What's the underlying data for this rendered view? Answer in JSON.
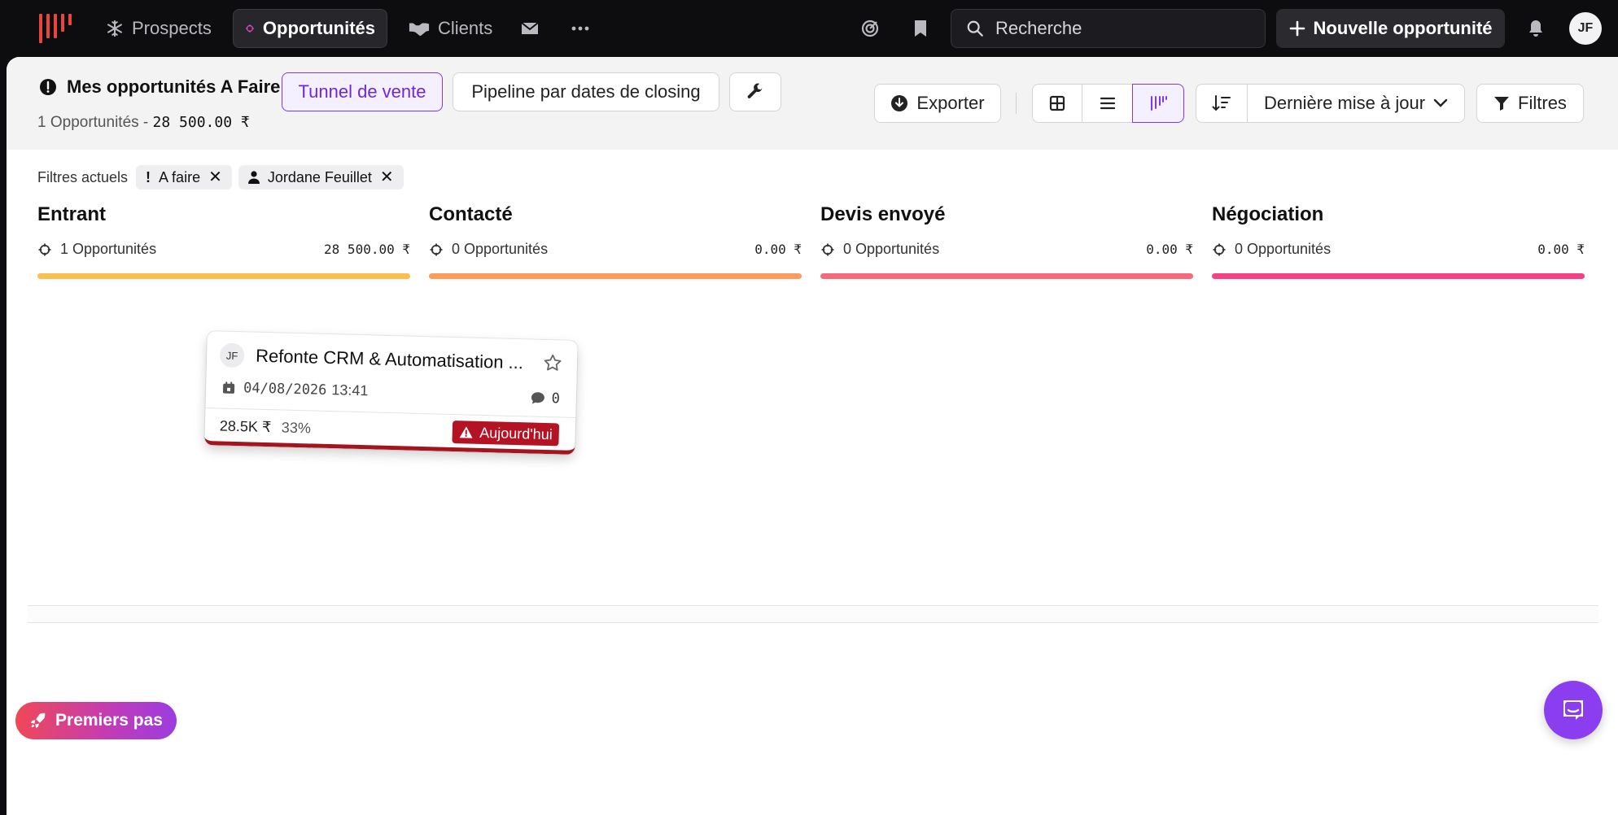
{
  "topbar": {
    "nav": {
      "prospects": "Prospects",
      "opportunites": "Opportunités",
      "clients": "Clients"
    },
    "search_placeholder": "Recherche",
    "new_button": "Nouvelle opportunité",
    "user_initials": "JF",
    "accent_color": "#7c3aed"
  },
  "header": {
    "title": "Mes opportunités A Faire",
    "view_tunnel": "Tunnel de vente",
    "view_pipeline": "Pipeline par dates de closing",
    "summary_count": "1 Opportunités -",
    "summary_amount": "28 500.00 ₹",
    "export": "Exporter",
    "sort_label": "Dernière mise à jour",
    "filters": "Filtres"
  },
  "filters": {
    "label": "Filtres actuels",
    "chips": [
      {
        "icon": "exclamation",
        "label": "A faire"
      },
      {
        "icon": "user-icon",
        "label": "Jordane Feuillet"
      }
    ]
  },
  "columns": [
    {
      "title": "Entrant",
      "count": "1 Opportunités",
      "amount": "28 500.00 ₹",
      "color": "#fbbf4f"
    },
    {
      "title": "Contacté",
      "count": "0 Opportunités",
      "amount": "0.00 ₹",
      "color": "#fb9b5c"
    },
    {
      "title": "Devis envoyé",
      "count": "0 Opportunités",
      "amount": "0.00 ₹",
      "color": "#f7687a"
    },
    {
      "title": "Négociation",
      "count": "0 Opportunités",
      "amount": "0.00 ₹",
      "color": "#f63f86"
    }
  ],
  "card": {
    "initials": "JF",
    "title": "Refonte CRM & Automatisation ...",
    "date": "04/08/2026",
    "time": "13:41",
    "comments": "0",
    "price": "28.5K ₹",
    "probability": "33%",
    "due": "Aujourd'hui"
  },
  "footer": {
    "premiers_pas": "Premiers pas"
  }
}
